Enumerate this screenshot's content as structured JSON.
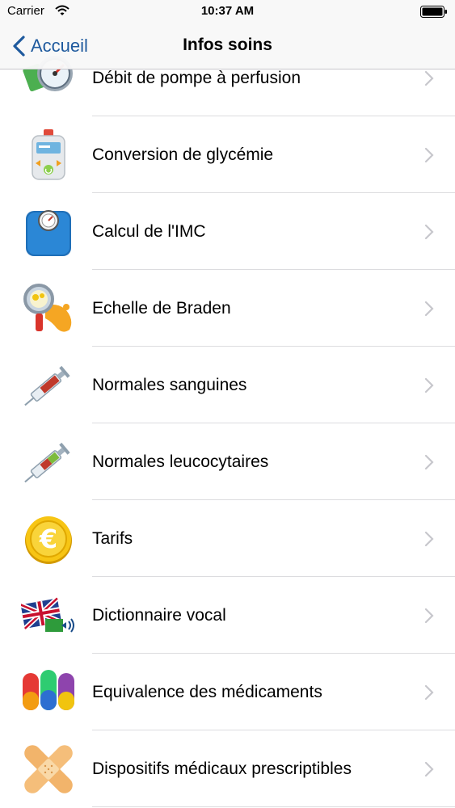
{
  "status_bar": {
    "carrier": "Carrier",
    "time": "10:37 AM"
  },
  "nav": {
    "back_label": "Accueil",
    "title": "Infos soins"
  },
  "items": [
    {
      "label": "Débit de pompe à perfusion",
      "icon": "pump-gauge-icon"
    },
    {
      "label": "Conversion de glycémie",
      "icon": "glucometer-icon"
    },
    {
      "label": "Calcul de l'IMC",
      "icon": "scale-icon"
    },
    {
      "label": "Echelle de Braden",
      "icon": "magnifier-foot-icon"
    },
    {
      "label": "Normales sanguines",
      "icon": "syringe-icon"
    },
    {
      "label": "Normales leucocytaires",
      "icon": "syringe-icon"
    },
    {
      "label": "Tarifs",
      "icon": "euro-coin-icon"
    },
    {
      "label": "Dictionnaire vocal",
      "icon": "flag-speaker-icon"
    },
    {
      "label": "Equivalence des médicaments",
      "icon": "pills-icon"
    },
    {
      "label": "Dispositifs médicaux prescriptibles",
      "icon": "bandage-icon"
    }
  ],
  "colors": {
    "accent": "#1f5a9e",
    "separator": "#dcdcdf",
    "chevron": "#c7c7cc"
  }
}
